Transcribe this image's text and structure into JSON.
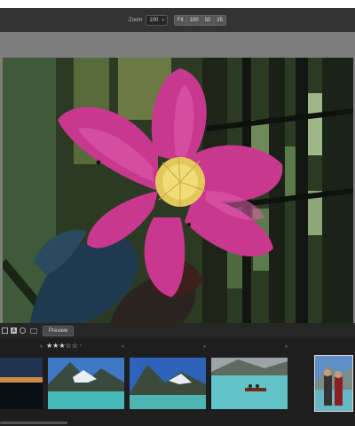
{
  "toolbar": {
    "zoom_label": "Zoom",
    "zoom_value": "100",
    "zoom_presets": [
      "Fit",
      "100",
      "50",
      "25"
    ]
  },
  "thumbnail_toolbar": {
    "badge_label": "A",
    "preview_label": "Preview"
  },
  "filmstrip": {
    "selected_rating": "★★★☆☆",
    "thumbnails": [
      {
        "subject": "sunset lake"
      },
      {
        "subject": "mountain glacier lake"
      },
      {
        "subject": "mountain lake valley"
      },
      {
        "subject": "canoe on turquoise lake"
      },
      {
        "subject": "couple portrait at lake"
      }
    ]
  },
  "colors": {
    "flower": "#c8388e",
    "viewer_bg": "#7d7d7d",
    "filmstrip_bg": "#1e1e1e"
  }
}
